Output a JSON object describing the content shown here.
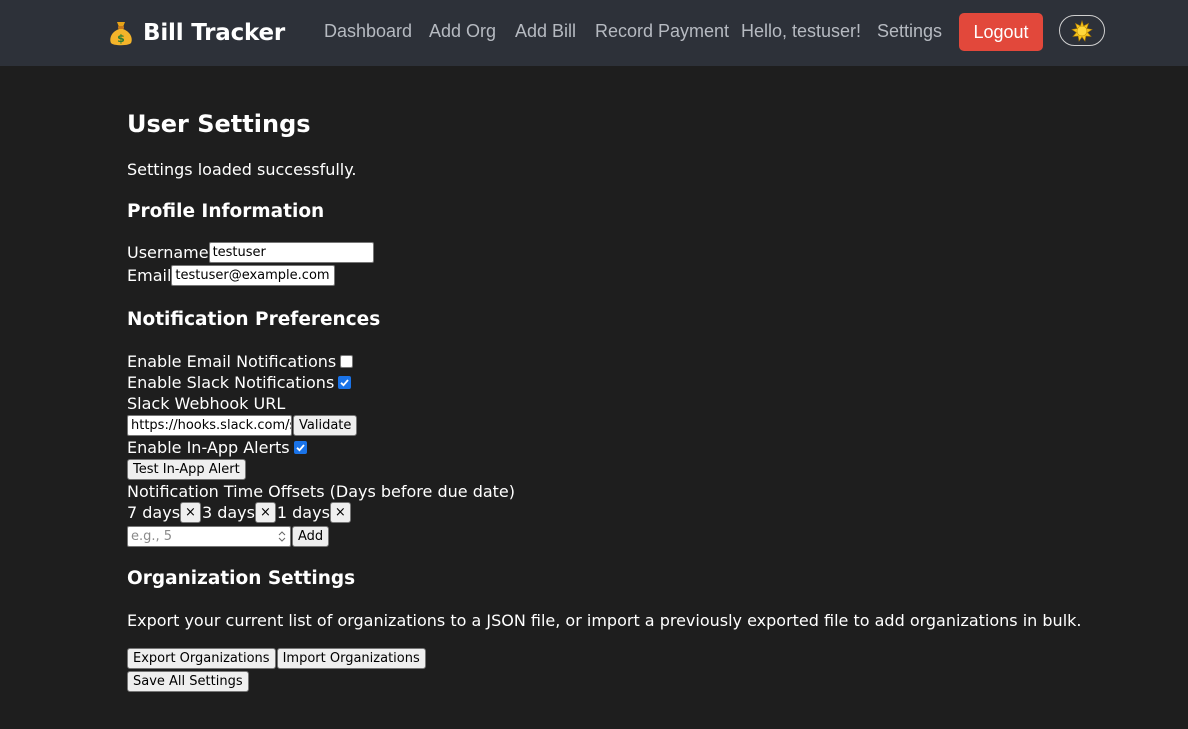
{
  "navbar": {
    "brand": "Bill Tracker",
    "brand_icon": "money-bag-icon",
    "links": [
      "Dashboard",
      "Add Org",
      "Add Bill",
      "Record Payment",
      "Hello, testuser!",
      "Settings"
    ],
    "logout_label": "Logout",
    "theme_icon": "sun-icon",
    "logout_color": "#e2483b"
  },
  "page": {
    "title": "User Settings",
    "status": "Settings loaded successfully."
  },
  "profile": {
    "heading": "Profile Information",
    "username_label": "Username",
    "username_value": "testuser",
    "email_label": "Email",
    "email_value": "testuser@example.com"
  },
  "notifications": {
    "heading": "Notification Preferences",
    "email_label": "Enable Email Notifications",
    "email_checked": false,
    "slack_label": "Enable Slack Notifications",
    "slack_checked": true,
    "webhook_label": "Slack Webhook URL",
    "webhook_value": "https://hooks.slack.com/se",
    "validate_label": "Validate",
    "inapp_label": "Enable In-App Alerts",
    "inapp_checked": true,
    "test_alert_label": "Test In-App Alert",
    "offsets_label": "Notification Time Offsets (Days before due date)",
    "offsets": [
      "7 days",
      "3 days",
      "1 days"
    ],
    "remove_glyph": "×",
    "offset_placeholder": "e.g., 5",
    "add_label": "Add"
  },
  "organization": {
    "heading": "Organization Settings",
    "description": "Export your current list of organizations to a JSON file, or import a previously exported file to add organizations in bulk.",
    "export_label": "Export Organizations",
    "import_label": "Import Organizations"
  },
  "save_label": "Save All Settings"
}
